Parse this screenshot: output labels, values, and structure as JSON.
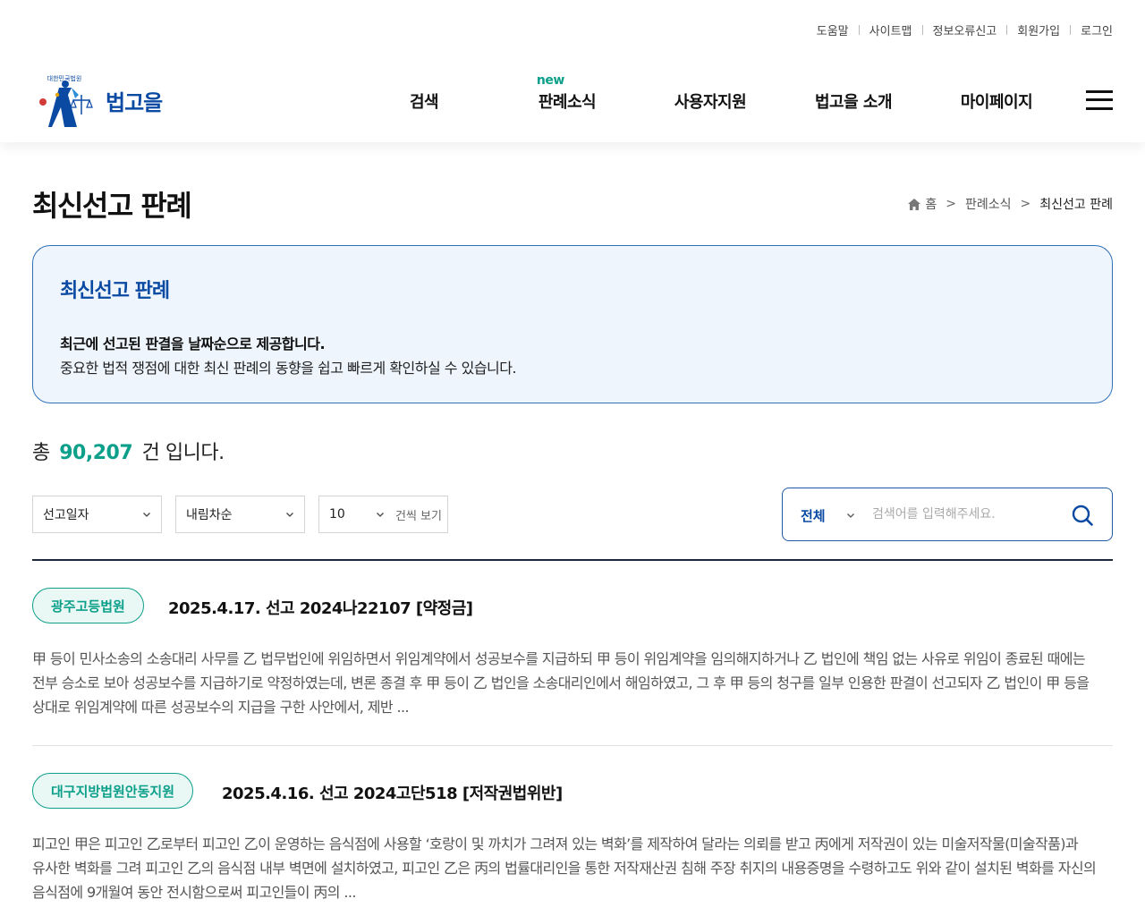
{
  "util_links": [
    "도움말",
    "사이트맵",
    "정보오류신고",
    "회원가입",
    "로그인"
  ],
  "logo": {
    "name": "법고을",
    "emblem_text": "대한민국법원"
  },
  "gnb": {
    "items": [
      "검색",
      "판례소식",
      "사용자지원",
      "법고을 소개",
      "마이페이지"
    ],
    "new_badge": "new"
  },
  "page_title": "최신선고 판례",
  "breadcrumb": {
    "home": "홈",
    "level1": "판례소식",
    "current": "최신선고 판례"
  },
  "info": {
    "title": "최신선고 판례",
    "line1": "최근에 선고된 판결을 날짜순으로 제공합니다.",
    "line2": "중요한 법적 쟁점에 대한 최신 판례의 동향을 쉽고 빠르게 확인하실 수 있습니다."
  },
  "total": {
    "prefix": "총",
    "count": "90,207",
    "suffix": "건 입니다."
  },
  "filters": {
    "sort_field": "선고일자",
    "sort_order": "내림차순",
    "page_size": "10",
    "page_size_unit": "건씩 보기"
  },
  "search": {
    "category": "전체",
    "placeholder": "검색어를 입력해주세요."
  },
  "results": [
    {
      "court": "광주고등법원",
      "title": "2025.4.17. 선고 2024나22107 [약정금]",
      "summary": "甲 등이 민사소송의 소송대리 사무를 乙 법무법인에 위임하면서 위임계약에서 성공보수를 지급하되 甲 등이 위임계약을 임의해지하거나 乙 법인에 책임 없는 사유로 위임이 종료된 때에는 전부 승소로 보아 성공보수를 지급하기로 약정하였는데, 변론 종결 후 甲 등이 乙 법인을 소송대리인에서 해임하였고, 그 후 甲 등의 청구를 일부 인용한 판결이 선고되자 乙 법인이 甲 등을 상대로 위임계약에 따른 성공보수의 지급을 구한 사안에서, 제반 ..."
    },
    {
      "court": "대구지방법원안동지원",
      "title": "2025.4.16. 선고 2024고단518 [저작권법위반]",
      "summary": "피고인 甲은 피고인 乙로부터 피고인 乙이 운영하는 음식점에 사용할 ‘호랑이 및 까치가 그려져 있는 벽화’를 제작하여 달라는 의뢰를 받고 丙에게 저작권이 있는 미술저작물(미술작품)과 유사한 벽화를 그려 피고인 乙의 음식점 내부 벽면에 설치하였고, 피고인 乙은 丙의 법률대리인을 통한 저작재산권 침해 주장 취지의 내용증명을 수령하고도 위와 같이 설치된 벽화를 자신의 음식점에 9개월여 동안 전시함으로써 피고인들이 丙의 ..."
    }
  ],
  "colors": {
    "brand_blue": "#0a4aa3",
    "accent_green": "#0c9f8a",
    "info_bg": "#eef5fd"
  }
}
